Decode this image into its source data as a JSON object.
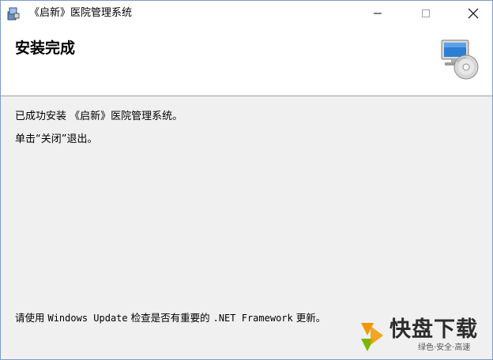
{
  "window": {
    "title": "《启新》医院管理系统",
    "minimize_label": "—",
    "maximize_label": "☐",
    "close_label": "✕"
  },
  "header": {
    "title": "安装完成",
    "icon": "computer-cd-icon"
  },
  "body": {
    "line1": "已成功安装 《启新》医院管理系统。",
    "line2": "单击“关闭”退出。",
    "line3_prefix": "请使用 ",
    "line3_windows_update": "Windows Update",
    "line3_middle": " 检查是否有重要的 ",
    "line3_net": ".NET Framework",
    "line3_suffix": " 更新。"
  },
  "watermark": {
    "title": "快盘下载",
    "subtitle": "绿色·安全·高速",
    "colors": {
      "orange": "#f39800",
      "green": "#7ab800"
    }
  }
}
